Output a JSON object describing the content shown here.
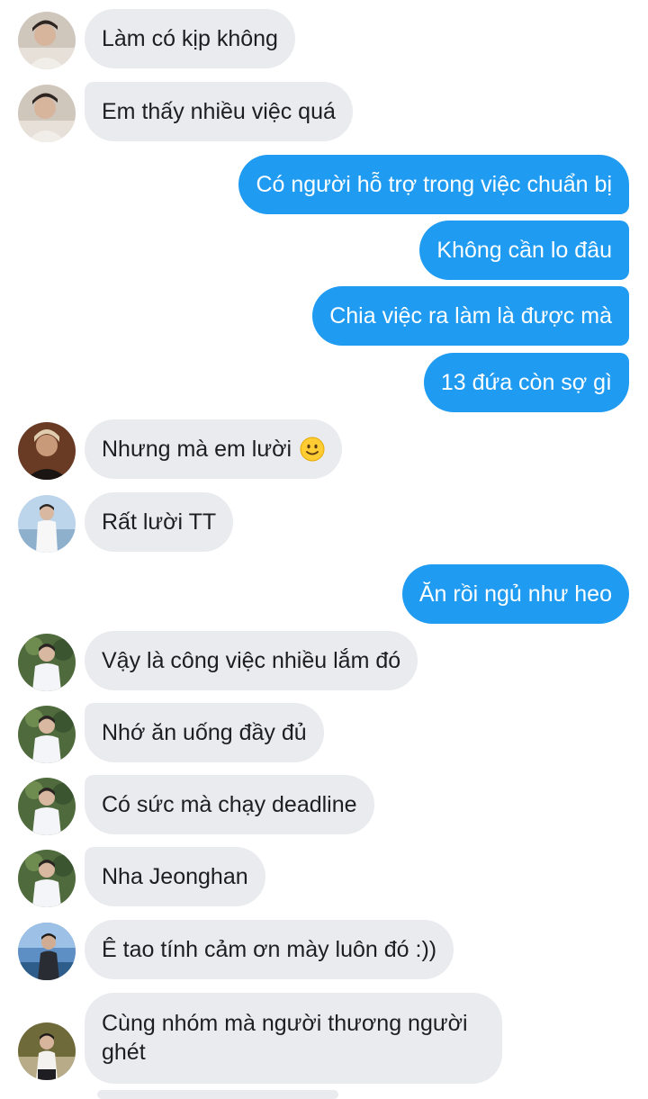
{
  "messages": [
    {
      "direction": "in",
      "avatar": "avatar-a",
      "text": "Làm có kịp không"
    },
    {
      "direction": "in",
      "avatar": "avatar-a",
      "text": "Em thấy nhiều việc quá"
    },
    {
      "direction": "out",
      "text": "Có người hỗ trợ trong việc chuẩn bị"
    },
    {
      "direction": "out",
      "text": "Không cần lo đâu"
    },
    {
      "direction": "out",
      "text": "Chia việc ra làm là được mà"
    },
    {
      "direction": "out",
      "text": "13 đứa còn sợ gì"
    },
    {
      "direction": "in",
      "avatar": "avatar-b",
      "text": "Nhưng mà em lười",
      "emoji": "slightly-smiling-face"
    },
    {
      "direction": "in",
      "avatar": "avatar-c",
      "text": "Rất lười TT"
    },
    {
      "direction": "out",
      "text": "Ăn rồi ngủ như heo"
    },
    {
      "direction": "in",
      "avatar": "avatar-d",
      "text": "Vậy là công việc nhiều lắm đó"
    },
    {
      "direction": "in",
      "avatar": "avatar-d",
      "text": "Nhớ ăn uống đầy đủ"
    },
    {
      "direction": "in",
      "avatar": "avatar-d",
      "text": "Có sức mà chạy deadline"
    },
    {
      "direction": "in",
      "avatar": "avatar-d",
      "text": "Nha Jeonghan"
    },
    {
      "direction": "in",
      "avatar": "avatar-e",
      "text": "Ê tao tính cảm ơn mày luôn đó :))"
    },
    {
      "direction": "in",
      "avatar": "avatar-f",
      "text": "Cùng nhóm mà người thương người ghét"
    }
  ],
  "colors": {
    "incoming_bubble": "#e9ebef",
    "outgoing_bubble": "#1f9bf2",
    "incoming_text": "#1c1e21",
    "outgoing_text": "#ffffff"
  }
}
